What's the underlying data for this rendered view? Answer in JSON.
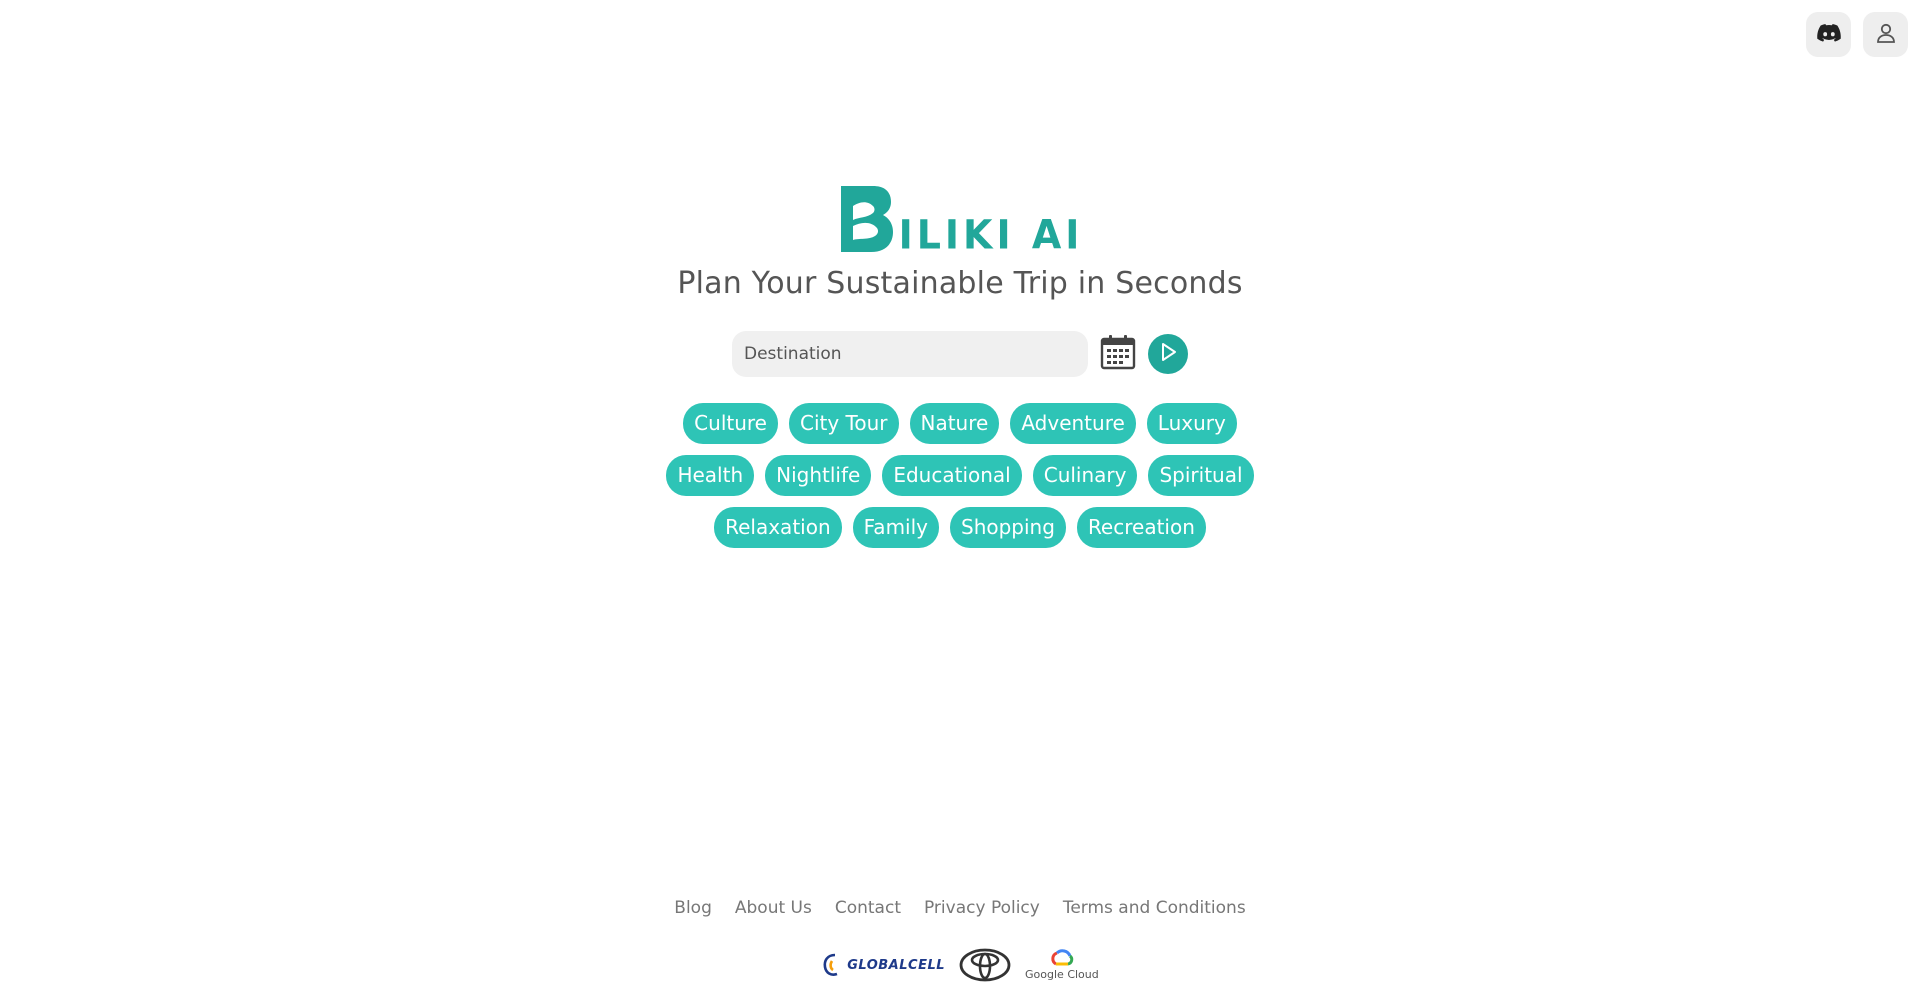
{
  "brand": {
    "name": "ILIKI AI",
    "accent_color": "#21a79a",
    "tag_color": "#2ec4b6"
  },
  "header": {
    "discord_icon": "discord-icon",
    "account_icon": "user-icon"
  },
  "hero": {
    "tagline": "Plan Your Sustainable Trip in Seconds"
  },
  "search": {
    "placeholder": "Destination",
    "value": "",
    "calendar_icon": "calendar-icon",
    "go_icon": "play-icon"
  },
  "tags": [
    "Culture",
    "City Tour",
    "Nature",
    "Adventure",
    "Luxury",
    "Health",
    "Nightlife",
    "Educational",
    "Culinary",
    "Spiritual",
    "Relaxation",
    "Family",
    "Shopping",
    "Recreation"
  ],
  "footer": {
    "links": [
      "Blog",
      "About Us",
      "Contact",
      "Privacy Policy",
      "Terms and Conditions"
    ]
  },
  "sponsors": {
    "globalcell": "GLOBALCELL",
    "google_cloud": "Google Cloud"
  }
}
